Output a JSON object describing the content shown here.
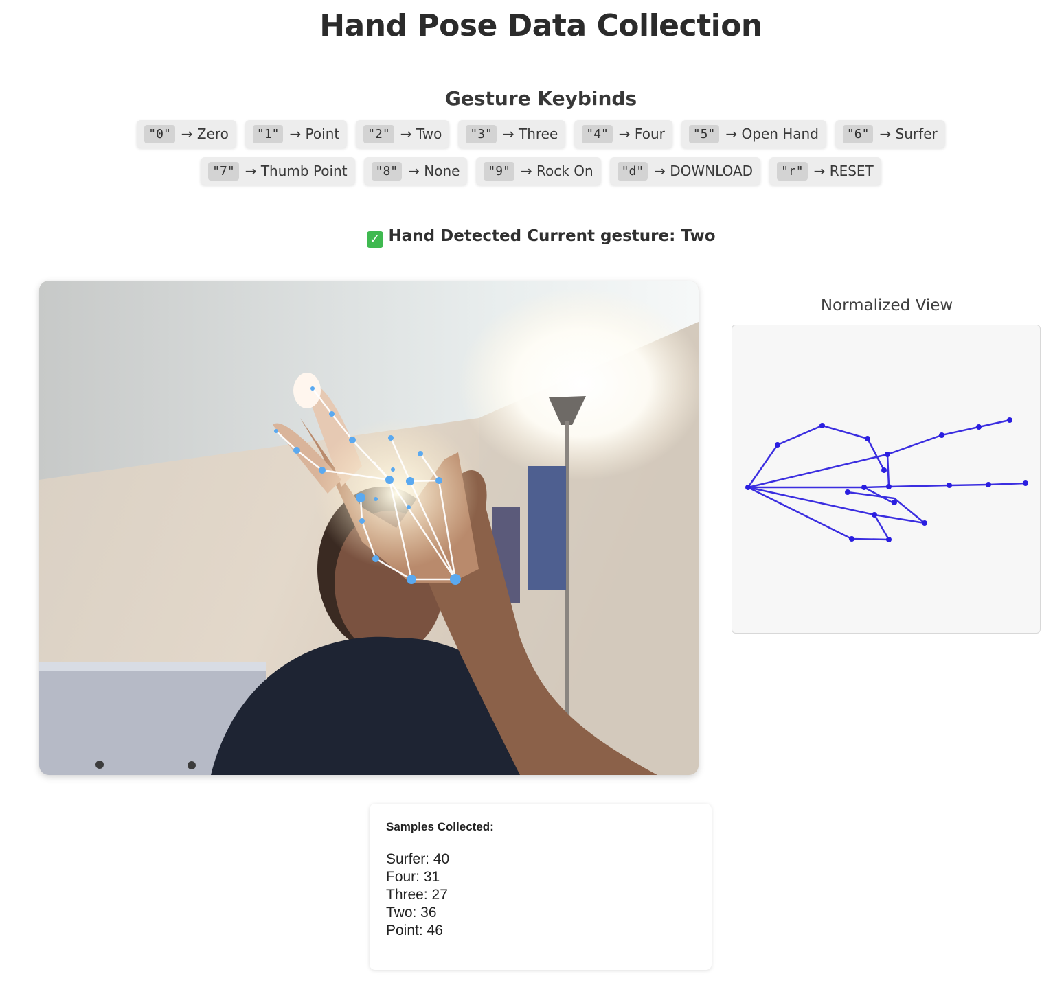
{
  "page": {
    "title": "Hand Pose Data Collection"
  },
  "keybinds": {
    "heading": "Gesture Keybinds",
    "row1": [
      {
        "key": "\"0\"",
        "label": "→ Zero"
      },
      {
        "key": "\"1\"",
        "label": "→ Point"
      },
      {
        "key": "\"2\"",
        "label": "→ Two"
      },
      {
        "key": "\"3\"",
        "label": "→ Three"
      },
      {
        "key": "\"4\"",
        "label": "→ Four"
      },
      {
        "key": "\"5\"",
        "label": "→ Open Hand"
      },
      {
        "key": "\"6\"",
        "label": "→ Surfer"
      }
    ],
    "row2": [
      {
        "key": "\"7\"",
        "label": "→ Thumb Point"
      },
      {
        "key": "\"8\"",
        "label": "→ None"
      },
      {
        "key": "\"9\"",
        "label": "→ Rock On"
      },
      {
        "key": "\"d\"",
        "label": "→ DOWNLOAD"
      },
      {
        "key": "\"r\"",
        "label": "→ RESET"
      }
    ]
  },
  "status": {
    "icon": "check-mark-icon",
    "text": "Hand Detected Current gesture: Two",
    "color": "#3fb950"
  },
  "webcam": {
    "landmark_color": "#5aa9f0",
    "connection_color": "#ffffff"
  },
  "normalized_view": {
    "title": "Normalized View",
    "line_color": "#3b2ee0"
  },
  "samples": {
    "title": "Samples Collected:",
    "lines": [
      "Surfer: 40",
      "Four: 31",
      "Three: 27",
      "Two: 36",
      "Point: 46"
    ]
  }
}
